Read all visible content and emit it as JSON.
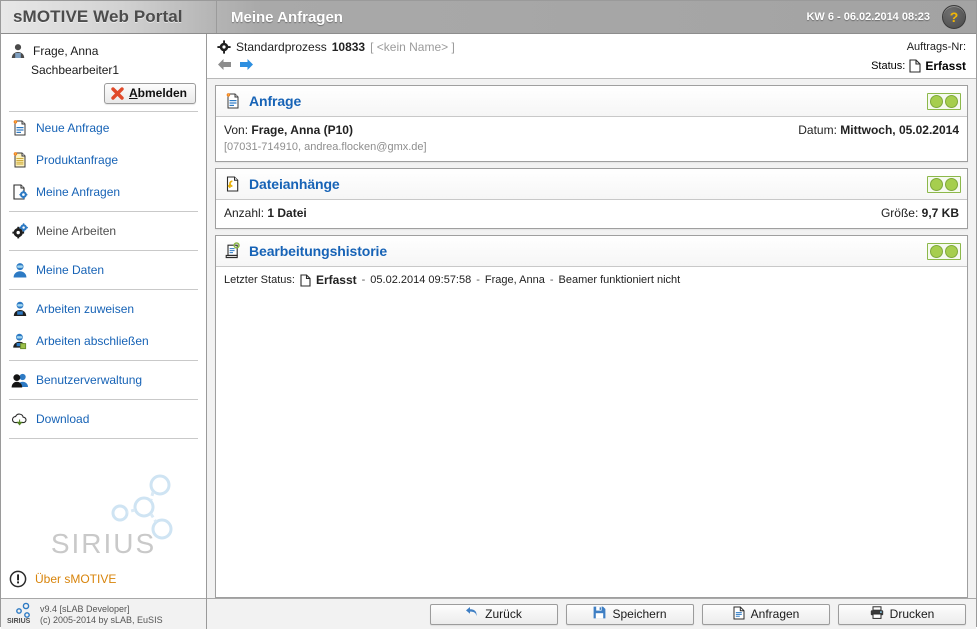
{
  "header": {
    "brand": "sMOTIVE Web Portal",
    "page_title": "Meine Anfragen",
    "kw_datetime": "KW 6 - 06.02.2014 08:23",
    "help_label": "?"
  },
  "sidebar": {
    "user": {
      "name": "Frage, Anna",
      "role": "Sachbearbeiter1",
      "logout_label": "Abmelden",
      "logout_accesskey": "A",
      "logout_rest": "bmelden"
    },
    "items": [
      {
        "label": "Neue Anfrage",
        "icon": "new-request-icon",
        "current": false
      },
      {
        "label": "Produktanfrage",
        "icon": "product-request-icon",
        "current": false
      },
      {
        "label": "Meine Anfragen",
        "icon": "my-requests-icon",
        "current": true
      },
      {
        "label": "Meine Arbeiten",
        "icon": "gears-icon",
        "current": true
      },
      {
        "label": "Meine Daten",
        "icon": "user-data-icon",
        "current": false
      },
      {
        "label": "Arbeiten zuweisen",
        "icon": "assign-work-icon",
        "current": false
      },
      {
        "label": "Arbeiten abschließen",
        "icon": "complete-work-icon",
        "current": false
      },
      {
        "label": "Benutzerverwaltung",
        "icon": "user-management-icon",
        "current": false
      },
      {
        "label": "Download",
        "icon": "cloud-download-icon",
        "current": false
      }
    ],
    "logo_word": "SIRIUS",
    "about_label": "Über sMOTIVE",
    "footer_line1": "v9.4 [sLAB Developer]",
    "footer_line2": "(c) 2005-2014 by sLAB, EuSIS"
  },
  "process": {
    "type_label": "Standardprozess",
    "number": "10833",
    "name_placeholder": "[ <kein Name> ]",
    "order_no_label": "Auftrags-Nr:",
    "order_no_value": "",
    "status_label": "Status:",
    "status_value": "Erfasst",
    "nav_back": "back-arrow",
    "nav_forward": "forward-arrow"
  },
  "panels": [
    {
      "title": "Anfrage",
      "icon": "request-doc-icon",
      "rows": {
        "from_label": "Von:",
        "from_value": "Frage, Anna (P10)",
        "date_label": "Datum:",
        "date_value": "Mittwoch, 05.02.2014",
        "contact": "[07031-714910, andrea.flocken@gmx.de]"
      }
    },
    {
      "title": "Dateianhänge",
      "icon": "attachment-doc-icon",
      "rows": {
        "count_label": "Anzahl:",
        "count_value": "1 Datei",
        "size_label": "Größe:",
        "size_value": "9,7 KB"
      }
    },
    {
      "title": "Bearbeitungshistorie",
      "icon": "history-scroll-icon",
      "rows": {
        "last_status_label": "Letzter Status:",
        "last_status_value": "Erfasst",
        "timestamp": "05.02.2014 09:57:58",
        "user": "Frage, Anna",
        "comment": "Beamer funktioniert nicht",
        "separator": "-"
      }
    }
  ],
  "footer_buttons": [
    {
      "label": "Zurück",
      "icon": "back-arrow-icon"
    },
    {
      "label": "Speichern",
      "icon": "save-disk-icon"
    },
    {
      "label": "Anfragen",
      "icon": "requests-doc-icon"
    },
    {
      "label": "Drucken",
      "icon": "printer-icon"
    }
  ],
  "colors": {
    "link_blue": "#1763b6",
    "accent_orange": "#d8840b",
    "toggle_green": "#a6ce4e",
    "header_gray": "#a3a3a3"
  }
}
